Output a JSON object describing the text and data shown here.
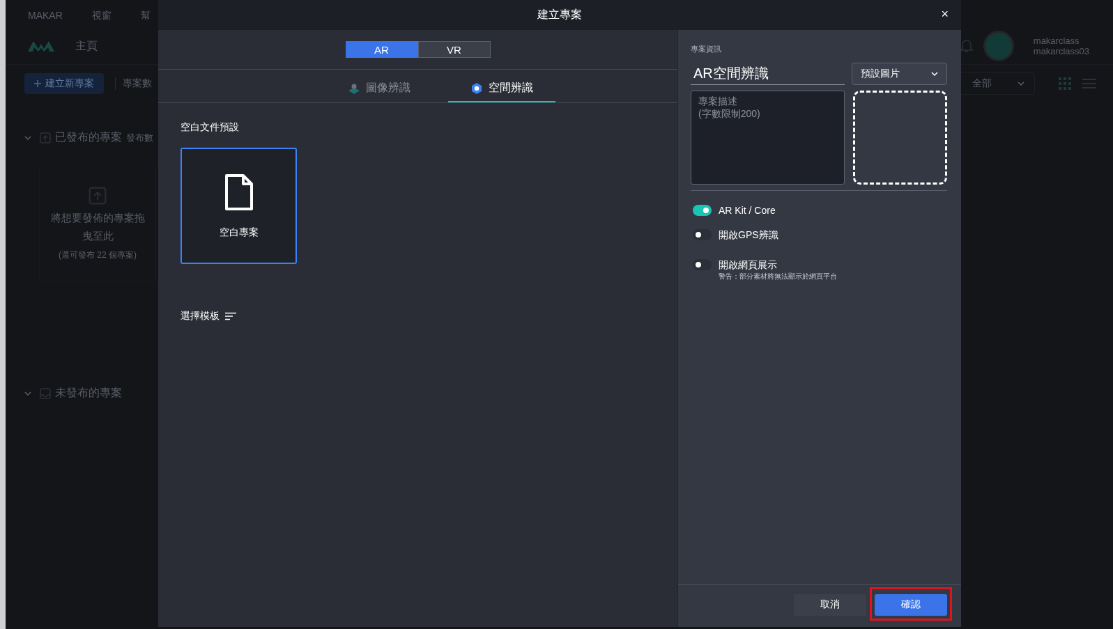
{
  "background": {
    "menu": [
      "MAKAR",
      "視窗",
      "幫"
    ],
    "header": {
      "title": "主頁",
      "user_name": "makarclass",
      "user_id": "makarclass03"
    },
    "toolbar": {
      "create_button": "建立新專案",
      "count_label": "專案數",
      "filter": "全部"
    },
    "published": {
      "title": "已發布的專案",
      "count_label": "發布數",
      "drop_text": "將想要發佈的專案拖曳至此",
      "drop_hint": "(還可發布 22 個專案)",
      "expanded": true
    },
    "unpublished": {
      "title": "未發布的專案",
      "expanded": true
    }
  },
  "dialog": {
    "title": "建立專案",
    "close": "×",
    "modes": [
      {
        "label": "AR",
        "selected": true
      },
      {
        "label": "VR",
        "selected": false
      }
    ],
    "tabs": [
      {
        "label": "圖像辨識",
        "kind": "image",
        "selected": false
      },
      {
        "label": "空間辨識",
        "kind": "space",
        "selected": true
      }
    ],
    "blank_section": "空白文件預設",
    "blank_card": {
      "label": "空白專案",
      "selected": true
    },
    "template_label": "選擇模板",
    "info": {
      "heading": "專案資訊",
      "name": "AR空間辨識",
      "image_select": "預設圖片",
      "description_placeholder": "專案描述\n(字數限制200)",
      "toggles": [
        {
          "label": "AR Kit / Core",
          "on": true
        },
        {
          "label": "開啟GPS辨識",
          "on": false
        },
        {
          "label": "開啟網頁展示",
          "on": false,
          "note": "警告：部分素材將無法顯示於網頁平台"
        }
      ]
    },
    "buttons": [
      {
        "label": "取消",
        "kind": "secondary"
      },
      {
        "label": "確認",
        "kind": "primary",
        "highlighted": true
      }
    ]
  }
}
